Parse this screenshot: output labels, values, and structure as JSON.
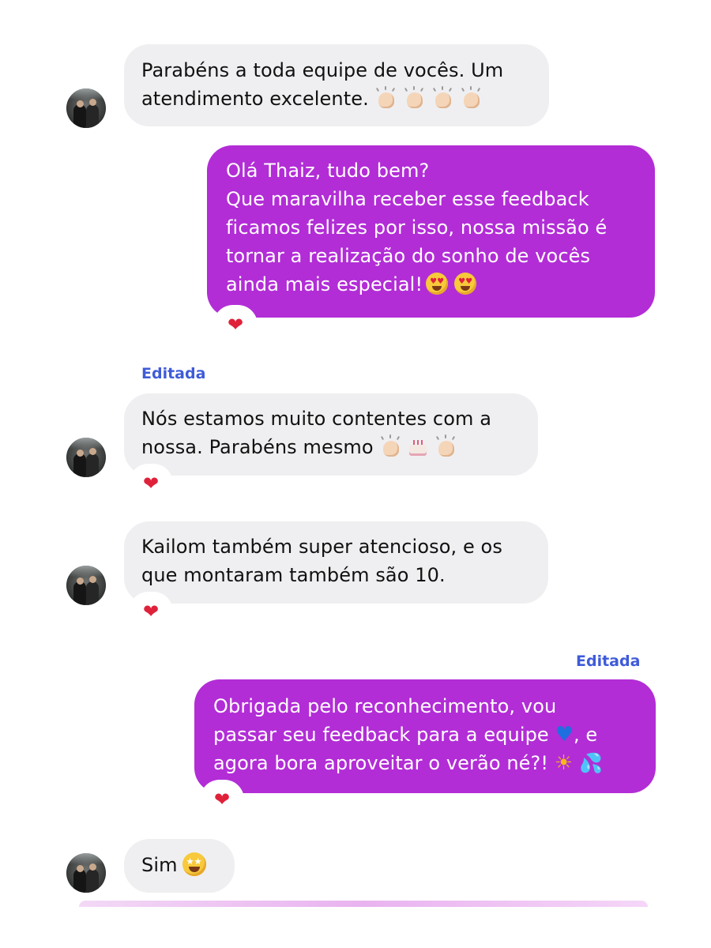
{
  "conversation": {
    "messages": [
      {
        "direction": "incoming",
        "lines": [
          "Parabéns a toda equipe de vocês. Um",
          "atendimento excelente."
        ],
        "emojis": [
          "clapping-hands",
          "clapping-hands",
          "clapping-hands",
          "clapping-hands"
        ]
      },
      {
        "direction": "outgoing",
        "lines": [
          "Olá Thaiz, tudo bem?",
          "Que maravilha receber esse feedback",
          "ficamos felizes por isso, nossa missão é",
          "tornar a realização do sonho de vocês",
          "ainda mais especial!"
        ],
        "emojis": [
          "heart-eyes",
          "heart-eyes"
        ],
        "reaction": "❤"
      },
      {
        "direction": "incoming",
        "edited_label": "Editada",
        "lines": [
          "Nós estamos muito contentes com a",
          "nossa. Parabéns mesmo"
        ],
        "emojis": [
          "clapping-hands",
          "birthday-cake",
          "clapping-hands"
        ],
        "reaction": "❤"
      },
      {
        "direction": "incoming",
        "lines": [
          "Kailom também super atencioso, e os",
          "que montaram também são 10."
        ],
        "reaction": "❤"
      },
      {
        "direction": "outgoing",
        "edited_label": "Editada",
        "lines": [
          "Obrigada pelo reconhecimento, vou",
          "passar seu feedback para a equipe",
          "agora bora aproveitar o verão né?!"
        ],
        "line2_suffix": ", e",
        "emojis": [
          "blue-heart",
          "sun",
          "sweat-droplets"
        ],
        "reaction": "❤"
      },
      {
        "direction": "incoming",
        "lines": [
          "Sim"
        ],
        "emojis": [
          "star-struck"
        ]
      }
    ]
  },
  "colors": {
    "incoming_bubble": "#efeff1",
    "outgoing_bubble": "#b22dd6",
    "edited_label": "#3f5bd8",
    "reaction_heart": "#e0213a"
  }
}
